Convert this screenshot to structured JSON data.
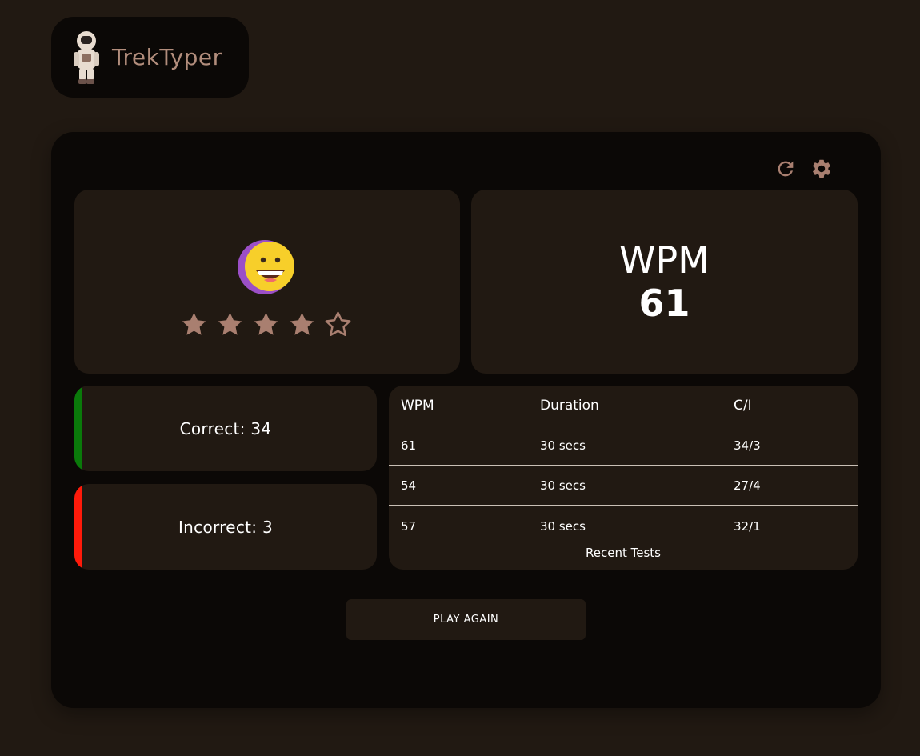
{
  "app": {
    "name": "TrekTyper"
  },
  "toolbar": {
    "restart_icon": "restart-icon",
    "settings_icon": "gear-icon"
  },
  "result": {
    "emoji": "grinning-face-emoji",
    "rating": 4,
    "rating_max": 5,
    "wpm_label": "WPM",
    "wpm_value": "61"
  },
  "counts": {
    "correct_text": "Correct: 34",
    "incorrect_text": "Incorrect: 3",
    "correct_color": "#0a7a0a",
    "incorrect_color": "#ff1a0a"
  },
  "recent_tests": {
    "headers": [
      "WPM",
      "Duration",
      "C/I"
    ],
    "rows": [
      [
        "61",
        "30 secs",
        "34/3"
      ],
      [
        "54",
        "30 secs",
        "27/4"
      ],
      [
        "57",
        "30 secs",
        "32/1"
      ]
    ],
    "caption": "Recent Tests"
  },
  "actions": {
    "play_again_label": "PLAY AGAIN"
  },
  "colors": {
    "background": "#211912",
    "panel": "#0b0806",
    "accent": "#a97f70",
    "text": "#ffffff"
  }
}
